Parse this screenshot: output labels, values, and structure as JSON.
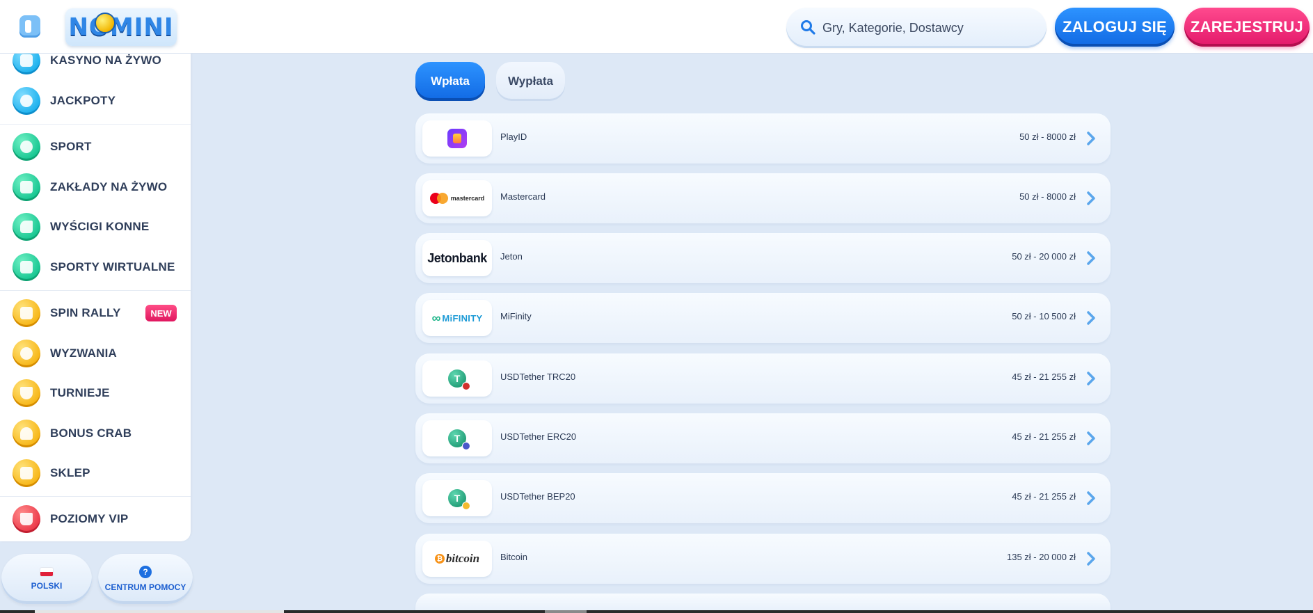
{
  "header": {
    "logo_text": "NOMINI",
    "search_placeholder": "Gry, Kategorie, Dostawcy",
    "login_label": "ZALOGUJ SIĘ",
    "register_label": "ZAREJESTRUJ"
  },
  "sidebar": {
    "items": [
      {
        "label": "KASYNO NA ŻYWO",
        "icon": "live-casino-icon"
      },
      {
        "label": "JACKPOTY",
        "icon": "jackpot-icon"
      },
      {
        "label": "SPORT",
        "icon": "soccer-ball-icon"
      },
      {
        "label": "ZAKŁADY NA ŻYWO",
        "icon": "live-bets-icon"
      },
      {
        "label": "WYŚCIGI KONNE",
        "icon": "horse-icon"
      },
      {
        "label": "SPORTY WIRTUALNE",
        "icon": "virtual-sports-icon"
      },
      {
        "label": "SPIN RALLY",
        "icon": "flag-icon",
        "badge": "NEW"
      },
      {
        "label": "WYZWANIA",
        "icon": "medal-icon"
      },
      {
        "label": "TURNIEJE",
        "icon": "trophy-icon"
      },
      {
        "label": "BONUS CRAB",
        "icon": "crab-icon"
      },
      {
        "label": "SKLEP",
        "icon": "shop-icon"
      },
      {
        "label": "POZIOMY VIP",
        "icon": "crown-icon"
      }
    ],
    "language_label": "POLSKI",
    "help_label": "CENTRUM POMOCY"
  },
  "tabs": {
    "deposit": "Wpłata",
    "withdraw": "Wypłata"
  },
  "payments": [
    {
      "name": "PlayID",
      "range": "50 zł - 8000 zł",
      "logo": "playid-logo"
    },
    {
      "name": "Mastercard",
      "range": "50 zł - 8000 zł",
      "logo": "mastercard-logo",
      "logo_text": "mastercard"
    },
    {
      "name": "Jeton",
      "range": "50 zł - 20 000 zł",
      "logo": "jetonbank-logo",
      "logo_text": "Jetonbank"
    },
    {
      "name": "MiFinity",
      "range": "50 zł - 10 500 zł",
      "logo": "mifinity-logo",
      "logo_text": "MiFINITY"
    },
    {
      "name": "USDTether TRC20",
      "range": "45 zł - 21 255 zł",
      "logo": "tether-trc20-logo"
    },
    {
      "name": "USDTether ERC20",
      "range": "45 zł - 21 255 zł",
      "logo": "tether-erc20-logo"
    },
    {
      "name": "USDTether BEP20",
      "range": "45 zł - 21 255 zł",
      "logo": "tether-bep20-logo"
    },
    {
      "name": "Bitcoin",
      "range": "135 zł - 20 000 zł",
      "logo": "bitcoin-logo",
      "logo_text": "bitcoin"
    }
  ]
}
